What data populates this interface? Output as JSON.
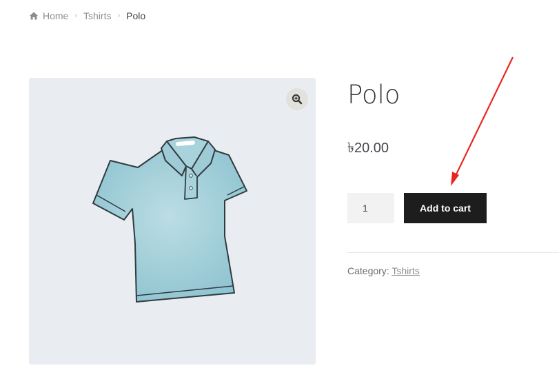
{
  "breadcrumb": {
    "home": "Home",
    "category": "Tshirts",
    "current": "Polo"
  },
  "product": {
    "title": "Polo",
    "price": "৳20.00",
    "quantity": "1",
    "add_to_cart_label": "Add to cart",
    "category_label": "Category:",
    "category_link": "Tshirts"
  },
  "icons": {
    "breadcrumb_home": "home-icon",
    "breadcrumb_separator": "chevron-right-icon",
    "gallery_zoom": "zoom-in-icon"
  },
  "colors": {
    "button_bg": "#1d1d1d",
    "annotation_arrow": "#e8261f",
    "gallery_bg": "#e9edf1"
  }
}
